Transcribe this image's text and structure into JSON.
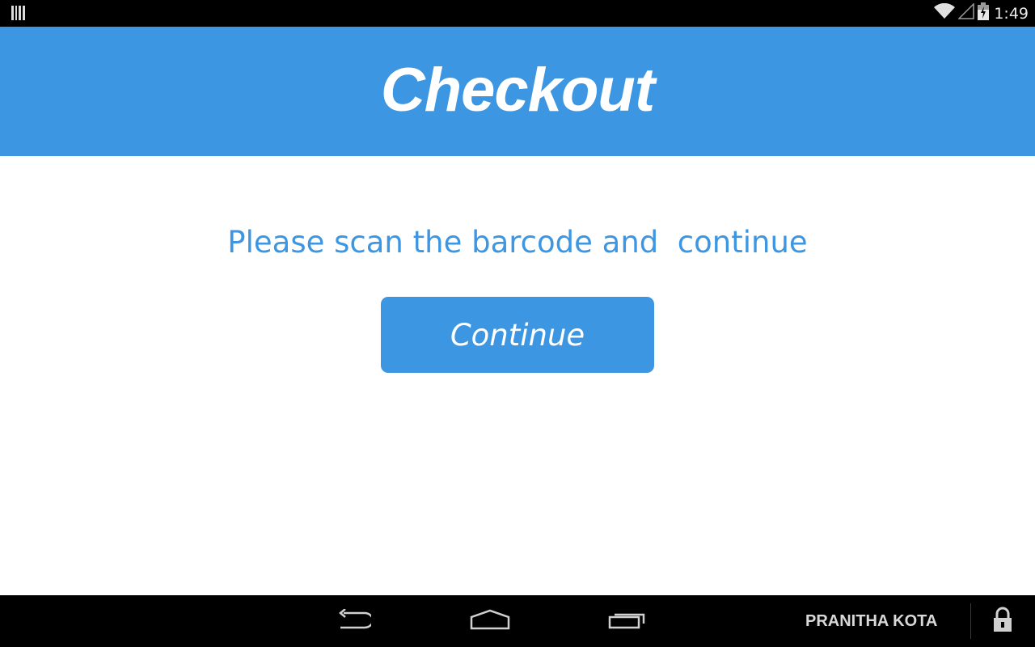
{
  "status_bar": {
    "time": "1:49",
    "icons": [
      "barcode-notification-icon",
      "wifi-icon",
      "signal-icon",
      "battery-icon"
    ]
  },
  "header": {
    "title": "Checkout",
    "color": "#3d96e2"
  },
  "main": {
    "prompt": "Please scan the barcode and  continue",
    "continue_label": "Continue"
  },
  "nav_bar": {
    "icons": [
      "back-icon",
      "home-icon",
      "recents-icon",
      "lock-icon"
    ],
    "user_name": "PRANITHA KOTA"
  }
}
